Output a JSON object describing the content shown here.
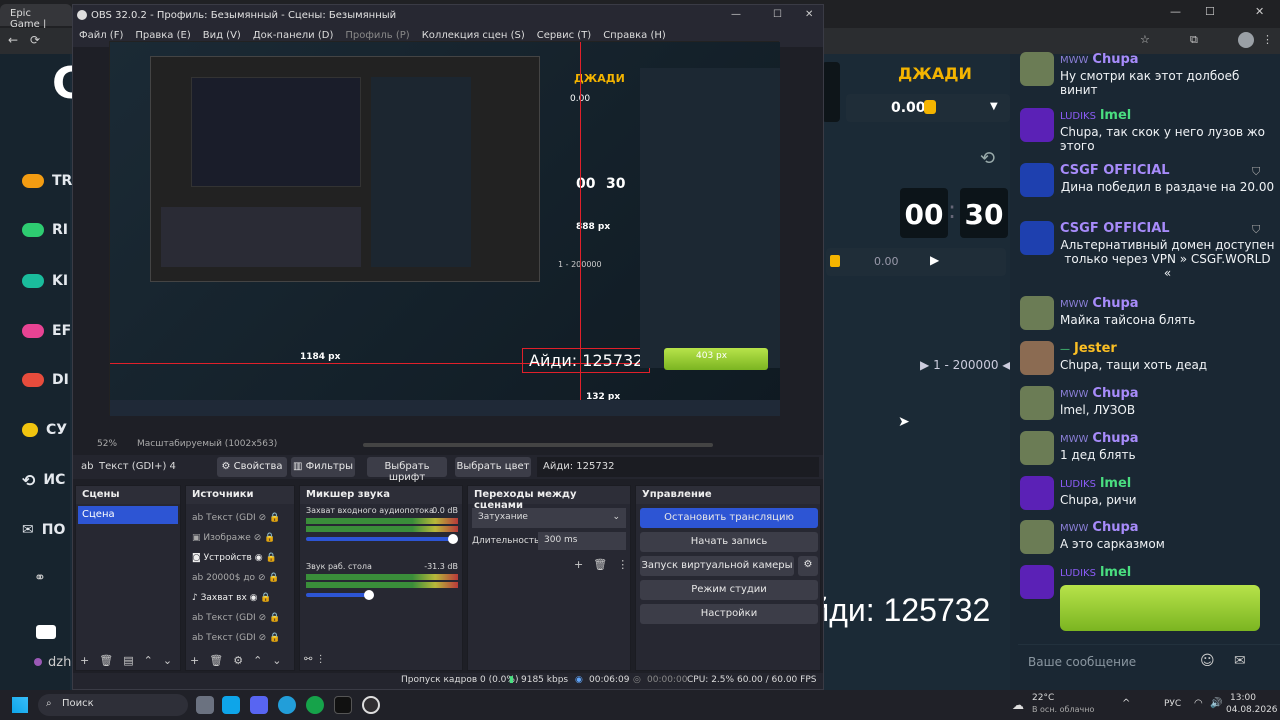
{
  "browser": {
    "tab_label": "Epic Game |",
    "window_controls": [
      "—",
      "☐",
      "✕"
    ]
  },
  "left_nav": {
    "items": [
      {
        "label": "TR",
        "color": "#f39c12"
      },
      {
        "label": "RI",
        "color": "#2ecc71"
      },
      {
        "label": "KI",
        "color": "#1abc9c"
      },
      {
        "label": "EF",
        "color": "#e84393"
      },
      {
        "label": "DI",
        "color": "#e74c3c"
      },
      {
        "label": "СУ",
        "color": "#f1c40f"
      },
      {
        "label": "ИС",
        "color": "#ecf0f1"
      },
      {
        "label": "ПО",
        "color": "#ecf0f1"
      }
    ],
    "footer": "dzh"
  },
  "game": {
    "player_name": "ДЖАДИ",
    "balance": "0.00",
    "timer_min": "00",
    "timer_sec": "30",
    "bet_value": "0.00",
    "range": "1 - 200000",
    "id_text": "Айди: 125732"
  },
  "chat": {
    "messages": [
      {
        "tag": "MWW",
        "name": "Chupa",
        "name_color": "#a78bfa",
        "text": "Ну смотри как этот долбоеб винит",
        "avatar_color": "#6b7c55"
      },
      {
        "tag": "LUDIKS",
        "name": "lmel",
        "name_color": "#4ade80",
        "text": "Chupa, так скок у него лузов жо этого",
        "avatar_color": "#7c3aed"
      },
      {
        "tag": "",
        "name": "CSGF OFFICIAL",
        "name_color": "#a78bfa",
        "text": "Дина победил в раздаче на 20.00",
        "avatar_color": "#2563eb"
      },
      {
        "tag": "",
        "name": "CSGF OFFICIAL",
        "name_color": "#a78bfa",
        "text": "Альтернативный домен доступен только через VPN » CSGF.WORLD «",
        "avatar_color": "#2563eb"
      },
      {
        "tag": "MWW",
        "name": "Chupa",
        "name_color": "#a78bfa",
        "text": "Майка тайсона блять",
        "avatar_color": "#6b7c55"
      },
      {
        "tag": "—",
        "name": "Jester",
        "name_color": "#fbbf24",
        "text": "Chupa, тащи хоть деад",
        "avatar_color": "#8b6b52"
      },
      {
        "tag": "MWW",
        "name": "Chupa",
        "name_color": "#a78bfa",
        "text": "lmel, ЛУЗОВ",
        "avatar_color": "#6b7c55"
      },
      {
        "tag": "MWW",
        "name": "Chupa",
        "name_color": "#a78bfa",
        "text": "1 дед блять",
        "avatar_color": "#6b7c55"
      },
      {
        "tag": "LUDIKS",
        "name": "lmel",
        "name_color": "#4ade80",
        "text": "Chupa, ричи",
        "avatar_color": "#7c3aed"
      },
      {
        "tag": "MWW",
        "name": "Chupa",
        "name_color": "#a78bfa",
        "text": "А это сарказмом",
        "avatar_color": "#6b7c55"
      },
      {
        "tag": "LUDIKS",
        "name": "lmel",
        "name_color": "#4ade80",
        "text": "",
        "avatar_color": "#7c3aed"
      }
    ],
    "input_placeholder": "Ваше сообщение"
  },
  "obs": {
    "title": "OBS 32.0.2 - Профиль: Безымянный - Сцены: Безымянный",
    "menu": [
      "Файл (F)",
      "Правка (E)",
      "Вид (V)",
      "Док-панели (D)",
      "Профиль (P)",
      "Коллекция сцен (S)",
      "Сервис (T)",
      "Справка (H)"
    ],
    "zoom": "52%",
    "scale_mode": "Масштабируемый (1002x563)",
    "source_toolbar": {
      "current": "Текст (GDI+) 4",
      "props": "Свойства",
      "filters": "Фильтры",
      "font": "Выбрать шрифт",
      "color": "Выбрать цвет",
      "text_value": "Айди: 125732"
    },
    "scenes": {
      "header": "Сцены",
      "items": [
        "Сцена"
      ]
    },
    "sources": {
      "header": "Источники",
      "items": [
        "Текст (GDI",
        "Изображе",
        "Устройств",
        "20000$ до",
        "Захват вх",
        "Текст (GDI",
        "Текст (GDI"
      ]
    },
    "mixer": {
      "header": "Микшер звука",
      "channels": [
        {
          "name": "Захват входного аудиопотока",
          "db": "0.0 dB"
        },
        {
          "name": "Звук раб. стола",
          "db": "-31.3 dB"
        }
      ],
      "scale": [
        "-60",
        "-55",
        "-50",
        "-45",
        "-40",
        "-35",
        "-30",
        "-25",
        "-20",
        "-15",
        "-10",
        "-5",
        "0"
      ]
    },
    "transitions": {
      "header": "Переходы между сценами",
      "type": "Затухание",
      "duration_label": "Длительность",
      "duration": "300 ms"
    },
    "controls": {
      "header": "Управление",
      "stop_stream": "Остановить трансляцию",
      "record": "Начать запись",
      "virtual_cam": "Запуск виртуальной камеры",
      "studio": "Режим студии",
      "settings": "Настройки"
    },
    "status": {
      "dropped": "Пропуск кадров 0 (0.0%)",
      "kbps": "9185 kbps",
      "stream_time": "00:06:09",
      "rec_time": "00:00:00",
      "cpu": "CPU: 2.5%",
      "fps": "60.00 / 60.00 FPS"
    },
    "preview_labels": {
      "px1": "888 px",
      "px2": "1184 px",
      "px3": "132 px",
      "px4": "403 px"
    }
  },
  "taskbar": {
    "search": "Поиск",
    "weather_temp": "22°C",
    "weather_desc": "В осн. облачно",
    "lang": "РУС",
    "time": "13:00",
    "date": "04.08.2026"
  }
}
